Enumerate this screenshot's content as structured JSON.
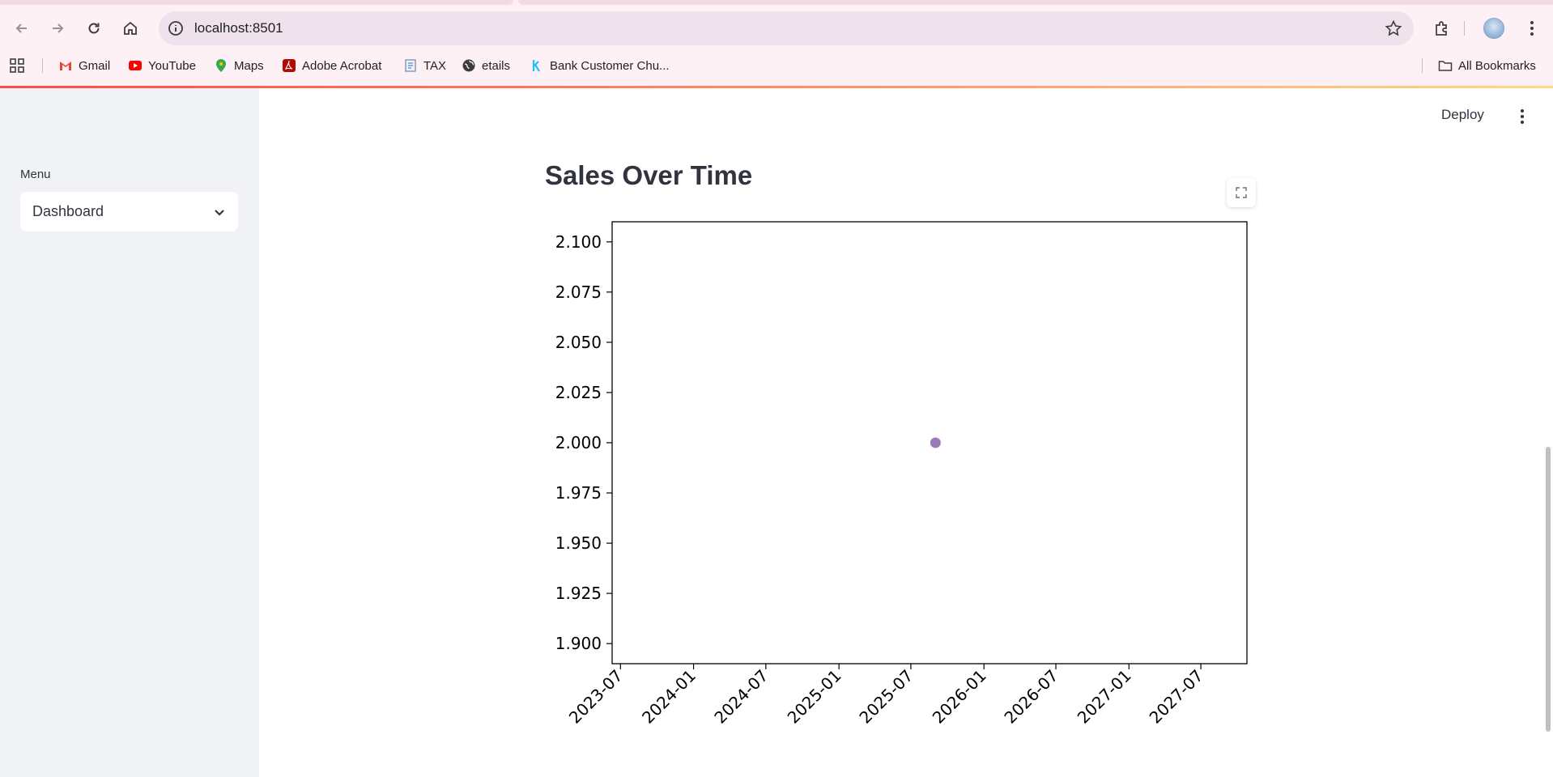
{
  "browser": {
    "url": "localhost:8501",
    "bookmarks": [
      {
        "label": "Gmail",
        "icon": "gmail-icon"
      },
      {
        "label": "YouTube",
        "icon": "youtube-icon"
      },
      {
        "label": "Maps",
        "icon": "maps-icon"
      },
      {
        "label": "Adobe Acrobat",
        "icon": "acrobat-icon"
      },
      {
        "label": "TAX",
        "icon": "doc-icon"
      },
      {
        "label": "etails",
        "icon": "globe-icon"
      },
      {
        "label": "Bank Customer Chu...",
        "icon": "kaggle-icon"
      }
    ],
    "all_bookmarks": "All Bookmarks"
  },
  "sidebar": {
    "menu_label": "Menu",
    "select_value": "Dashboard"
  },
  "header": {
    "deploy_label": "Deploy"
  },
  "main": {
    "title": "Sales Over Time"
  },
  "colors": {
    "accent": "#ff4b4b",
    "point": "#9a7bb8",
    "sidebar_bg": "#f0f2f6"
  },
  "chart_data": {
    "type": "scatter",
    "title": "",
    "xlabel": "",
    "ylabel": "",
    "x_ticks": [
      "2023-07",
      "2024-01",
      "2024-07",
      "2025-01",
      "2025-07",
      "2026-01",
      "2026-07",
      "2027-01",
      "2027-07"
    ],
    "y_ticks": [
      "1.900",
      "1.925",
      "1.950",
      "1.975",
      "2.000",
      "2.025",
      "2.050",
      "2.075",
      "2.100"
    ],
    "xlim": [
      "2023-06-10",
      "2027-10-25"
    ],
    "ylim": [
      1.89,
      2.11
    ],
    "points": [
      {
        "x": "2025-09-01",
        "y": 2.0
      }
    ],
    "grid": false
  }
}
